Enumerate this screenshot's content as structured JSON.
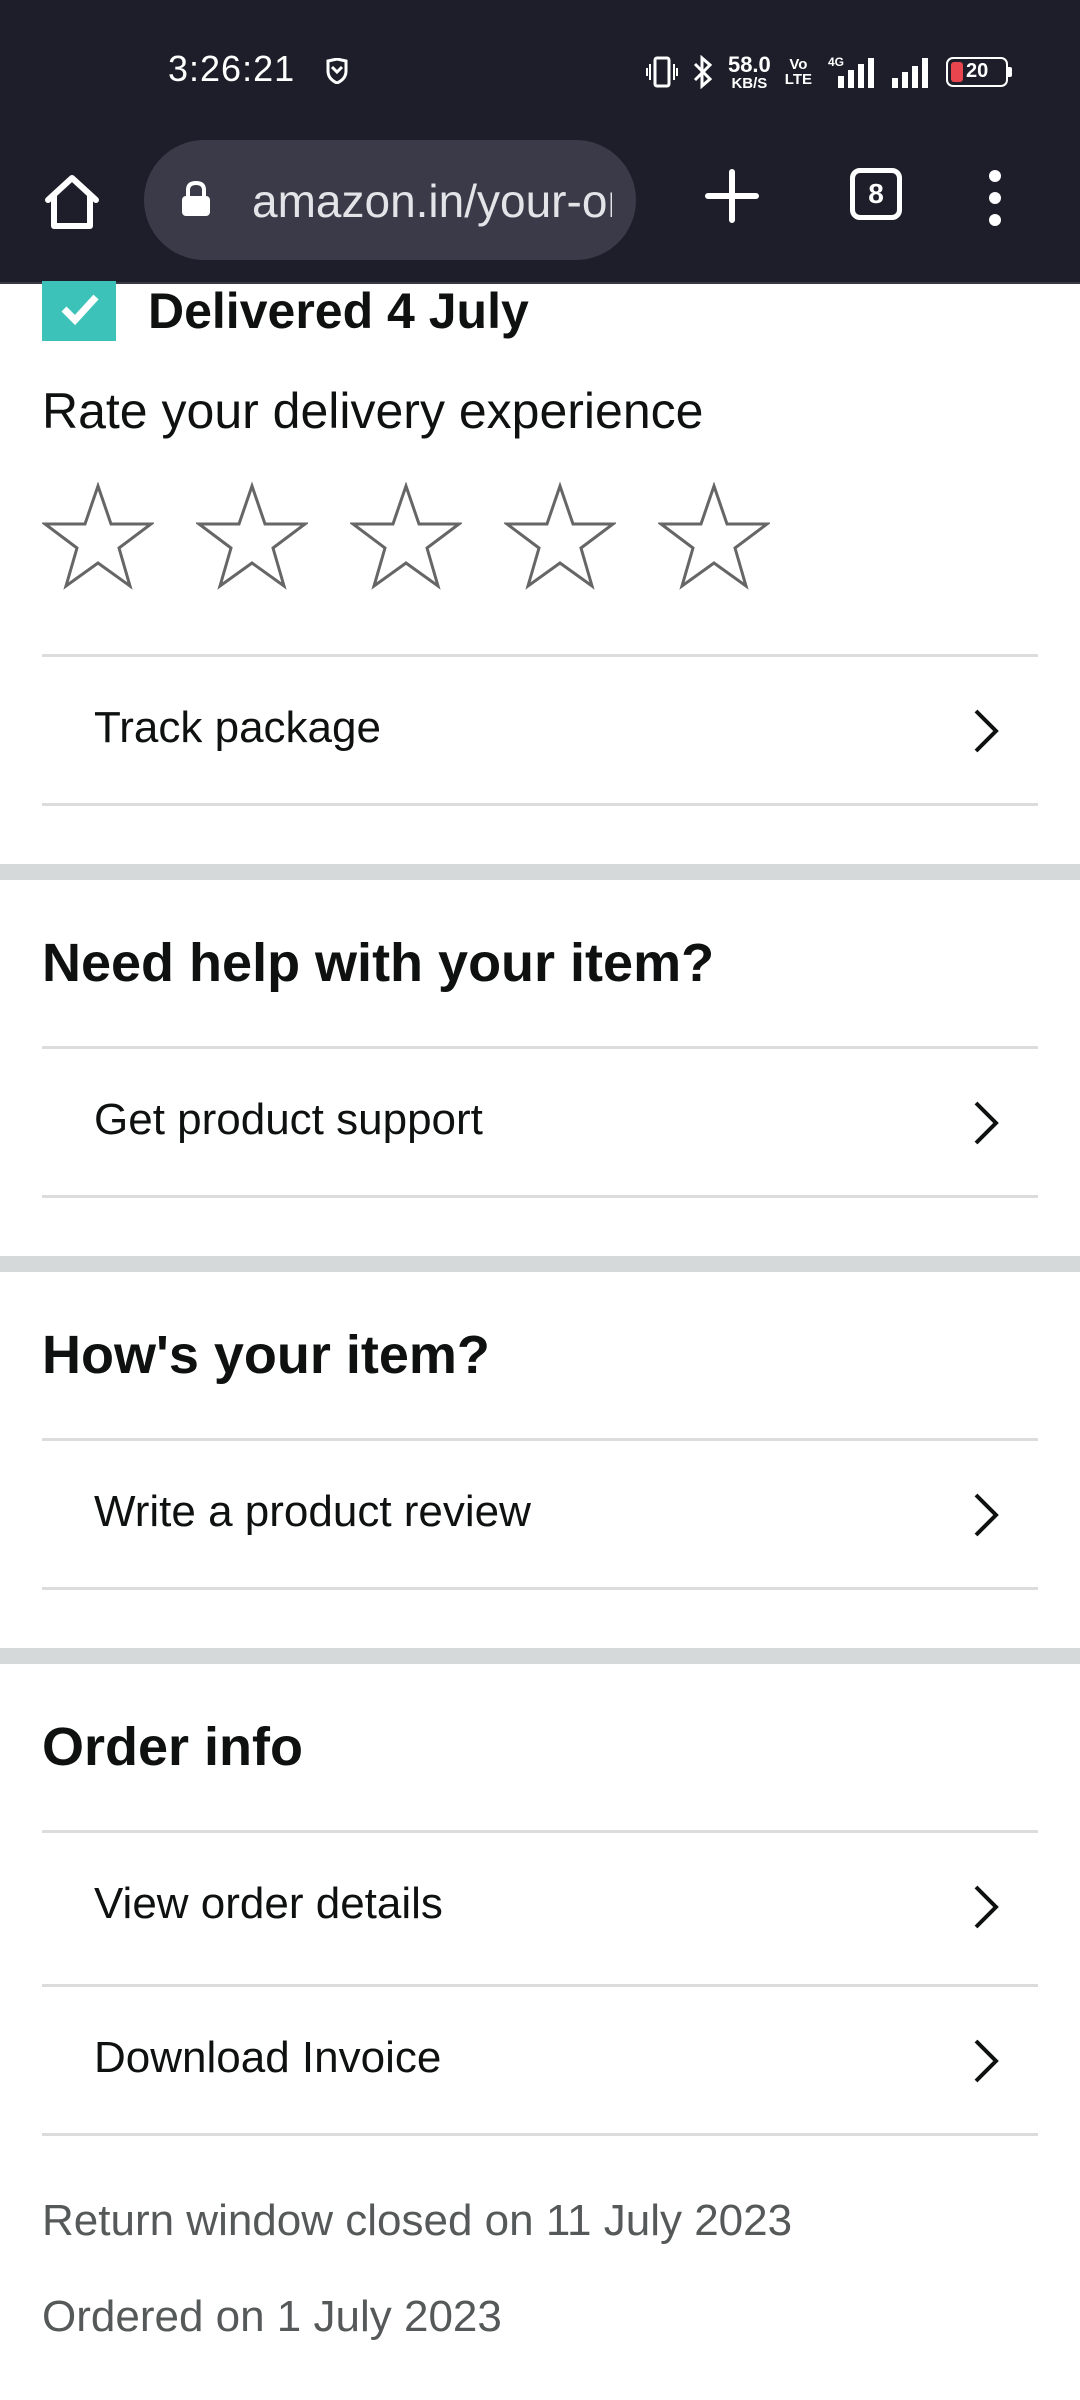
{
  "status_bar": {
    "time": "3:26:21",
    "speed_value": "58.0",
    "speed_unit": "KB/S",
    "volte_top": "Vo",
    "volte_bottom": "LTE",
    "network": "4G",
    "battery_level": "20",
    "battery_color": "#e8454e"
  },
  "browser": {
    "url": "amazon.in/your-orders",
    "tab_count": "8"
  },
  "delivery": {
    "status": "Delivered 4 July",
    "rate_title": "Rate your delivery experience",
    "star_count": 5,
    "track_label": "Track package"
  },
  "help_section": {
    "title": "Need help with your item?",
    "support_label": "Get product support"
  },
  "item_section": {
    "title": "How's your item?",
    "review_label": "Write a product review"
  },
  "order_info": {
    "title": "Order info",
    "view_details_label": "View order details",
    "invoice_label": "Download Invoice",
    "return_window": "Return window closed on 11 July 2023",
    "ordered_on": "Ordered on 1 July 2023"
  },
  "colors": {
    "status_bar_bg": "#1e1e2a",
    "check_accent": "#3cc2b8",
    "divider_band": "#d5d9d9"
  }
}
